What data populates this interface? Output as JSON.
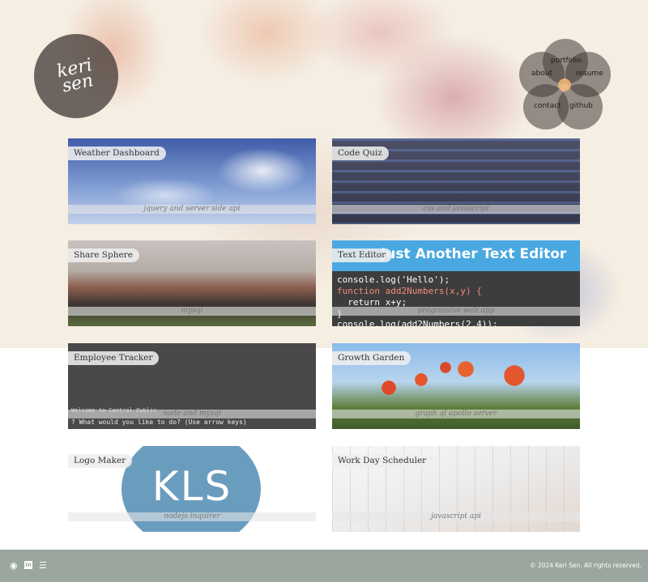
{
  "brand": {
    "logo_text": "keri\nsen"
  },
  "nav": {
    "portfolio": "portfolio",
    "about": "about",
    "resume": "resume",
    "contact": "contact",
    "github": "github"
  },
  "projects": [
    {
      "title": "Weather Dashboard",
      "subtitle": "jquery and server side api"
    },
    {
      "title": "Code Quiz",
      "subtitle": "css and javascript"
    },
    {
      "title": "Share Sphere",
      "subtitle": "mysql"
    },
    {
      "title": "Text Editor",
      "subtitle": "progressive web app"
    },
    {
      "title": "Employee Tracker",
      "subtitle": "node and mysql"
    },
    {
      "title": "Growth Garden",
      "subtitle": "graph ql apollo server"
    },
    {
      "title": "Logo Maker",
      "subtitle": "nodejs inquirer"
    },
    {
      "title": "Work Day Scheduler",
      "subtitle": "javascript api"
    }
  ],
  "thumbnails": {
    "text_editor_banner": "Just Another Text Editor",
    "code_line_1": "console.log('Hello');",
    "code_line_2": "function add2Numbers(x,y) {",
    "code_line_3": "  return x+y;",
    "code_line_4": "}",
    "code_line_5": "console.log(add2Numbers(2,4));",
    "tracker_line_1": "Welcome to Central Public",
    "tracker_line_2": "? What would you like to do? (Use arrow keys)",
    "logo_text": "KLS"
  },
  "footer": {
    "github_icon": "github-icon",
    "linkedin_icon": "linkedin-icon",
    "stackoverflow_icon": "stackoverflow-icon",
    "copyright": "© 2024 Keri Sen. All rights reserved."
  },
  "colors": {
    "footer_bg": "#9ba79e",
    "nav_circle": "#413a36",
    "logo_circle": "#463e3a"
  }
}
